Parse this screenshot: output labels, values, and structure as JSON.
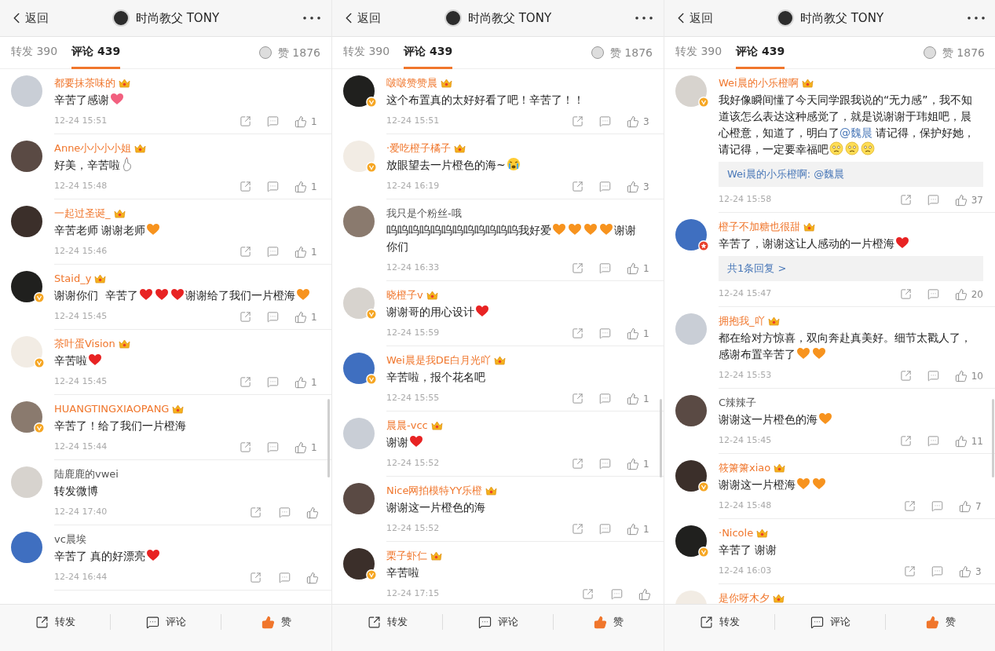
{
  "panels": [
    {
      "header": {
        "back": "返回",
        "title": "时尚教父 TONY"
      },
      "tabs": [
        {
          "label": "转发 390",
          "selected": false
        },
        {
          "label": "评论 439",
          "selected": true
        }
      ],
      "likes_tab": "赞 1876",
      "comments": [
        {
          "name": "都要抹茶味的",
          "vip": true,
          "parts": [
            {
              "kind": "text",
              "text": "辛苦了感谢"
            },
            {
              "kind": "heart",
              "color": "#f2607f"
            }
          ],
          "time": "12-24 15:51",
          "likes": "1"
        },
        {
          "name": "Anne小小小小姐",
          "vip": true,
          "parts": [
            {
              "kind": "text",
              "text": "好美，辛苦啦"
            },
            {
              "kind": "finger"
            }
          ],
          "time": "12-24 15:48",
          "likes": "1"
        },
        {
          "name": "一起过圣诞_",
          "vip": true,
          "parts": [
            {
              "kind": "text",
              "text": "辛苦老师 谢谢老师"
            },
            {
              "kind": "heart",
              "color": "#f7931e"
            }
          ],
          "time": "12-24 15:46",
          "likes": "1"
        },
        {
          "name": "Staid_y",
          "vip": true,
          "badge": {
            "kind": "verified",
            "color": "#f6a623"
          },
          "parts": [
            {
              "kind": "text",
              "text": "谢谢你们  辛苦了"
            },
            {
              "kind": "heart",
              "color": "#e82323"
            },
            {
              "kind": "heart",
              "color": "#e82323"
            },
            {
              "kind": "heart",
              "color": "#e82323"
            },
            {
              "kind": "text",
              "text": "谢谢给了我们一片橙海"
            },
            {
              "kind": "heart",
              "color": "#f7931e"
            }
          ],
          "time": "12-24 15:45",
          "likes": "1"
        },
        {
          "name": "茶叶蛋Vision",
          "vip": true,
          "badge": {
            "kind": "verified",
            "color": "#f6a623"
          },
          "parts": [
            {
              "kind": "text",
              "text": "辛苦啦"
            },
            {
              "kind": "heart",
              "color": "#e82323"
            }
          ],
          "time": "12-24 15:45",
          "likes": "1"
        },
        {
          "name": "HUANGTINGXIAOPANG",
          "vip": true,
          "badge": {
            "kind": "verified",
            "color": "#f6a623"
          },
          "parts": [
            {
              "kind": "text",
              "text": "辛苦了！给了我们一片橙海"
            }
          ],
          "time": "12-24 15:44",
          "likes": "1"
        },
        {
          "name": "陆鹿鹿的vwei",
          "vip": false,
          "parts": [
            {
              "kind": "text",
              "text": "转发微博"
            }
          ],
          "time": "12-24 17:40"
        },
        {
          "name": "vc晨埃",
          "vip": false,
          "parts": [
            {
              "kind": "text",
              "text": "辛苦了 真的好漂亮"
            },
            {
              "kind": "heart",
              "color": "#e82323"
            }
          ],
          "time": "12-24 16:44"
        }
      ],
      "bottom_bar": [
        {
          "kind": "share",
          "label": "转发"
        },
        {
          "kind": "comment",
          "label": "评论"
        },
        {
          "kind": "like",
          "label": "赞"
        }
      ]
    },
    {
      "header": {
        "back": "返回",
        "title": "时尚教父 TONY"
      },
      "tabs": [
        {
          "label": "转发 390",
          "selected": false
        },
        {
          "label": "评论 439",
          "selected": true
        }
      ],
      "likes_tab": "赞 1876",
      "comments": [
        {
          "name": "啵啵赞赞晨",
          "vip": true,
          "badge": {
            "kind": "verified",
            "color": "#f6a623"
          },
          "parts": [
            {
              "kind": "text",
              "text": "这个布置真的太好好看了吧！辛苦了！！"
            }
          ],
          "time": "12-24 15:51",
          "likes": "3"
        },
        {
          "name": "·爱吃橙子橘子",
          "vip": true,
          "badge": {
            "kind": "verified",
            "color": "#f6a623"
          },
          "parts": [
            {
              "kind": "text",
              "text": "放眼望去一片橙色的海~"
            },
            {
              "kind": "cry"
            }
          ],
          "time": "12-24 16:19",
          "likes": "3"
        },
        {
          "name": "我只是个粉丝-哦",
          "vip": false,
          "parts": [
            {
              "kind": "text",
              "text": "呜呜呜呜呜呜呜呜呜呜呜呜我好爱"
            },
            {
              "kind": "heart",
              "color": "#f7931e"
            },
            {
              "kind": "heart",
              "color": "#f7931e"
            },
            {
              "kind": "heart",
              "color": "#f7931e"
            },
            {
              "kind": "heart",
              "color": "#f7931e"
            },
            {
              "kind": "text",
              "text": "谢谢你们"
            }
          ],
          "time": "12-24 16:33",
          "likes": "1"
        },
        {
          "name": "晓橙子v",
          "vip": true,
          "badge": {
            "kind": "verified",
            "color": "#f6a623"
          },
          "parts": [
            {
              "kind": "text",
              "text": "谢谢哥的用心设计"
            },
            {
              "kind": "heart",
              "color": "#e82323"
            }
          ],
          "time": "12-24 15:59",
          "likes": "1"
        },
        {
          "name": "Wei晨是我DE白月光吖",
          "vip": true,
          "badge": {
            "kind": "verified",
            "color": "#f6a623"
          },
          "parts": [
            {
              "kind": "text",
              "text": "辛苦啦，报个花名吧"
            }
          ],
          "time": "12-24 15:55",
          "likes": "1"
        },
        {
          "name": "晨晨-vcc",
          "vip": true,
          "parts": [
            {
              "kind": "text",
              "text": "谢谢"
            },
            {
              "kind": "heart",
              "color": "#e82323"
            }
          ],
          "time": "12-24 15:52",
          "likes": "1"
        },
        {
          "name": "Nice网拍模特YY乐橙",
          "vip": true,
          "parts": [
            {
              "kind": "text",
              "text": "谢谢这一片橙色的海"
            }
          ],
          "time": "12-24 15:52",
          "likes": "1"
        },
        {
          "name": "栗子虾仁",
          "vip": true,
          "badge": {
            "kind": "verified",
            "color": "#f6a623"
          },
          "parts": [
            {
              "kind": "text",
              "text": "辛苦啦"
            }
          ],
          "time": "12-24 17:15"
        }
      ],
      "bottom_bar": [
        {
          "kind": "share",
          "label": "转发"
        },
        {
          "kind": "comment",
          "label": "评论"
        },
        {
          "kind": "like",
          "label": "赞"
        }
      ]
    },
    {
      "header": {
        "back": "返回",
        "title": "时尚教父 TONY"
      },
      "tabs": [
        {
          "label": "转发 390",
          "selected": false
        },
        {
          "label": "评论 439",
          "selected": true
        }
      ],
      "likes_tab": "赞 1876",
      "comments": [
        {
          "name": "Wei晨的小乐橙啊",
          "vip": true,
          "badge": {
            "kind": "verified",
            "color": "#f6a623"
          },
          "parts": [
            {
              "kind": "text",
              "text": "我好像瞬间懂了今天同学跟我说的“无力感”，我不知道该怎么表达这种感觉了，就是说谢谢于玮姐吧，晨心橙意，知道了，明白了"
            },
            {
              "kind": "mention",
              "text": "@魏晨"
            },
            {
              "kind": "text",
              "text": " 请记得，保护好她，请记得，一定要幸福吧"
            },
            {
              "kind": "sad"
            },
            {
              "kind": "sad"
            },
            {
              "kind": "sad"
            }
          ],
          "reply": "Wei晨的小乐橙啊: @魏晨",
          "time": "12-24 15:58",
          "likes": "37"
        },
        {
          "name": "橙子不加糖也很甜",
          "vip": true,
          "badge": {
            "kind": "member",
            "color": "#e8402c"
          },
          "parts": [
            {
              "kind": "text",
              "text": "辛苦了，谢谢这让人感动的一片橙海"
            },
            {
              "kind": "heart",
              "color": "#e82323"
            }
          ],
          "reply": "共1条回复 >",
          "time": "12-24 15:47",
          "likes": "20"
        },
        {
          "name": "拥抱我_吖",
          "vip": true,
          "parts": [
            {
              "kind": "text",
              "text": "都在给对方惊喜，双向奔赴真美好。细节太戳人了，感谢布置辛苦了"
            },
            {
              "kind": "heart",
              "color": "#f7931e"
            },
            {
              "kind": "heart",
              "color": "#f7931e"
            }
          ],
          "time": "12-24 15:53",
          "likes": "10"
        },
        {
          "name": "C辣辣子",
          "vip": false,
          "parts": [
            {
              "kind": "text",
              "text": "谢谢这一片橙色的海"
            },
            {
              "kind": "heart",
              "color": "#f7931e"
            }
          ],
          "time": "12-24 15:45",
          "likes": "11"
        },
        {
          "name": "筱箫箫xiao",
          "vip": true,
          "badge": {
            "kind": "verified",
            "color": "#f6a623"
          },
          "parts": [
            {
              "kind": "text",
              "text": "谢谢这一片橙海"
            },
            {
              "kind": "heart",
              "color": "#f7931e"
            },
            {
              "kind": "heart",
              "color": "#f7931e"
            }
          ],
          "time": "12-24 15:48",
          "likes": "7"
        },
        {
          "name": "·Nicole",
          "vip": true,
          "badge": {
            "kind": "verified",
            "color": "#f6a623"
          },
          "parts": [
            {
              "kind": "text",
              "text": "辛苦了 谢谢"
            }
          ],
          "time": "12-24 16:03",
          "likes": "3"
        },
        {
          "name": "是你呀木夕",
          "vip": true
        }
      ],
      "bottom_bar": [
        {
          "kind": "share",
          "label": "转发"
        },
        {
          "kind": "comment",
          "label": "评论"
        },
        {
          "kind": "like",
          "label": "赞"
        }
      ]
    }
  ]
}
